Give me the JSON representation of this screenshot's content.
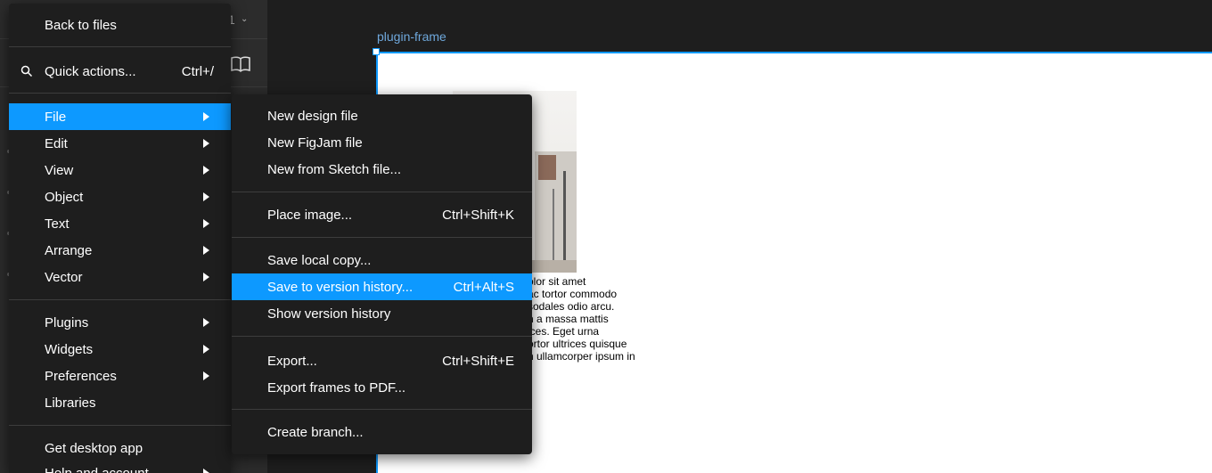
{
  "left_panel": {
    "page_number": "1",
    "chevron": "⌄"
  },
  "canvas": {
    "frame_label": "plugin-frame",
    "body_text": [
      "olor sit amet",
      "ac tortor commodo",
      "sodales odio arcu.",
      "n a massa mattis",
      "ices. Eget urna",
      "ortor ultrices quisque",
      "n ullamcorper ipsum in"
    ]
  },
  "main_menu": {
    "back": "Back to files",
    "quick_actions": {
      "label": "Quick actions...",
      "shortcut": "Ctrl+/"
    },
    "items": [
      {
        "label": "File",
        "submenu": true,
        "highlighted": true
      },
      {
        "label": "Edit",
        "submenu": true
      },
      {
        "label": "View",
        "submenu": true
      },
      {
        "label": "Object",
        "submenu": true
      },
      {
        "label": "Text",
        "submenu": true
      },
      {
        "label": "Arrange",
        "submenu": true
      },
      {
        "label": "Vector",
        "submenu": true
      }
    ],
    "items2": [
      {
        "label": "Plugins",
        "submenu": true
      },
      {
        "label": "Widgets",
        "submenu": true
      },
      {
        "label": "Preferences",
        "submenu": true
      },
      {
        "label": "Libraries"
      }
    ],
    "get_desktop_app": "Get desktop app",
    "help_and_account": "Help and account"
  },
  "file_menu": {
    "group1": [
      "New design file",
      "New FigJam file",
      "New from Sketch file..."
    ],
    "place_image": {
      "label": "Place image...",
      "shortcut": "Ctrl+Shift+K"
    },
    "save_local_copy": "Save local copy...",
    "save_version": {
      "label": "Save to version history...",
      "shortcut": "Ctrl+Alt+S"
    },
    "show_version_history": "Show version history",
    "export": {
      "label": "Export...",
      "shortcut": "Ctrl+Shift+E"
    },
    "export_frames": "Export frames to PDF...",
    "create_branch": "Create branch..."
  },
  "colors": {
    "accent": "#0d99ff",
    "menu_bg": "#1e1e1e",
    "panel_bg": "#2c2c2c"
  }
}
